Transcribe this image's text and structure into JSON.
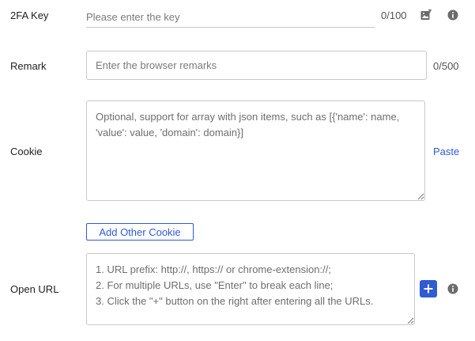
{
  "twofa": {
    "label": "2FA Key",
    "placeholder": "Please enter the key",
    "counter": "0/100",
    "image_icon": "image-add-icon",
    "info_icon": "info-icon"
  },
  "remark": {
    "label": "Remark",
    "placeholder": "Enter the browser remarks",
    "counter": "0/500"
  },
  "cookie": {
    "label": "Cookie",
    "placeholder": "Optional, support for array with json items, such as [{'name': name, 'value': value, 'domain': domain}]",
    "paste_label": "Paste",
    "add_other_label": "Add Other Cookie"
  },
  "open_url": {
    "label": "Open URL",
    "placeholder": "1. URL prefix: http://, https:// or chrome-extension://;\n2. For multiple URLs, use \"Enter\" to break each line;\n3. Click the \"+\" button on the right after entering all the URLs.",
    "add_icon": "plus-icon",
    "info_icon": "info-icon"
  },
  "colors": {
    "accent": "#2f5bd3",
    "border": "#c9c9c9",
    "icon": "#6b6b6b"
  }
}
